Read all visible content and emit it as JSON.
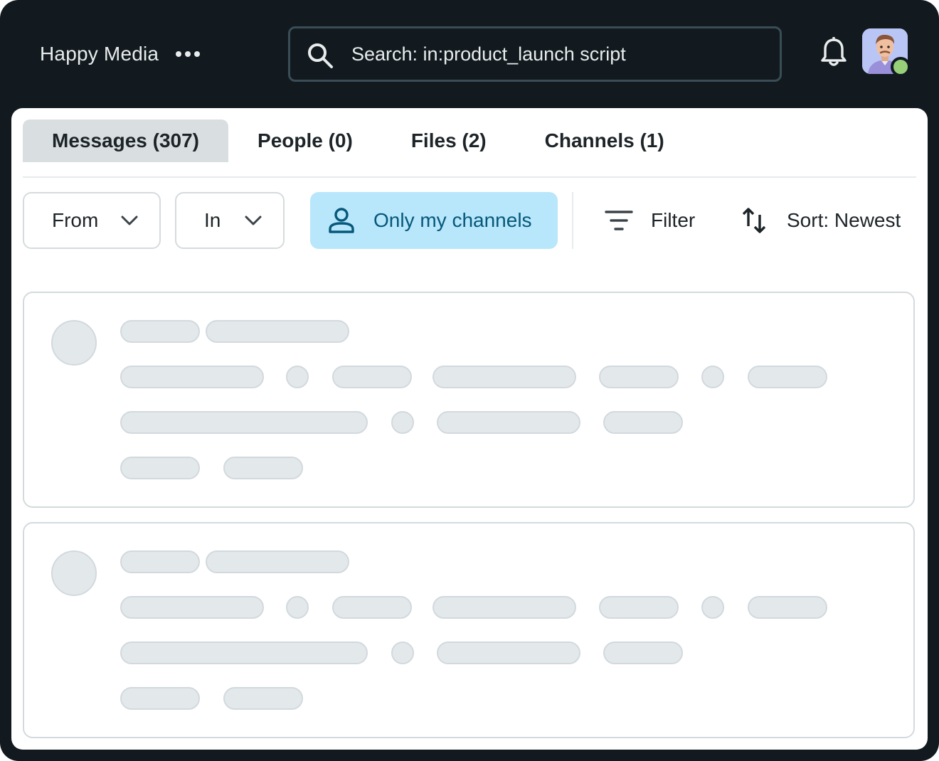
{
  "workspace": {
    "name": "Happy Media"
  },
  "search": {
    "value": "Search: in:product_launch script"
  },
  "tabs": [
    {
      "label": "Messages (307)",
      "active": true
    },
    {
      "label": "People (0)",
      "active": false
    },
    {
      "label": "Files (2)",
      "active": false
    },
    {
      "label": "Channels (1)",
      "active": false
    }
  ],
  "filters": {
    "from_label": "From",
    "in_label": "In",
    "only_my_channels_label": "Only my channels",
    "filter_label": "Filter",
    "sort_label": "Sort: Newest"
  },
  "icons": {
    "workspace_menu": "more-horizontal-icon",
    "search": "search-icon",
    "notifications": "bell-icon",
    "dropdown": "chevron-down-icon",
    "person": "person-icon",
    "filter": "filter-icon",
    "sort": "sort-icon"
  },
  "colors": {
    "app_background": "#121a1f",
    "active_tab": "#d9dee1",
    "active_chip": "#b8e6fa",
    "active_chip_text": "#06587a",
    "presence": "#98d07a",
    "skeleton_fill": "#e3e8eb"
  },
  "results": {
    "loading_placeholders": 2
  }
}
